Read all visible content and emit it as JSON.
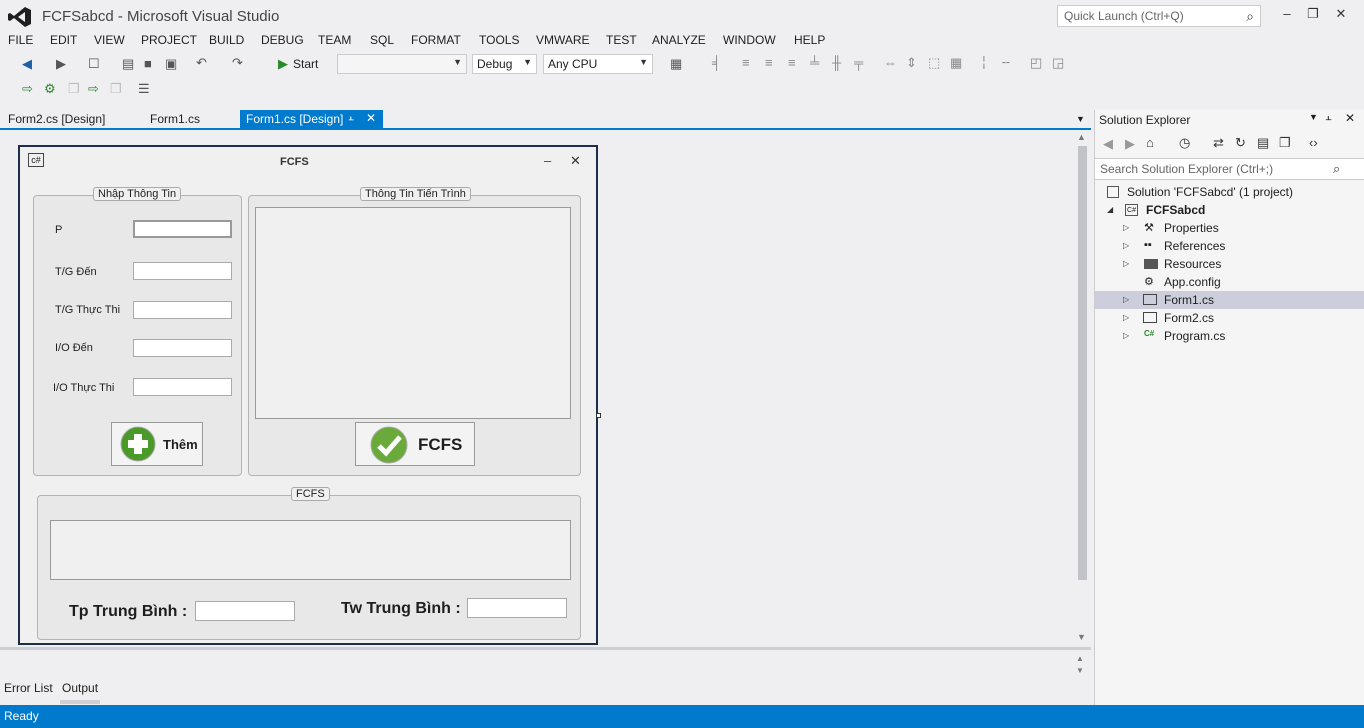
{
  "window": {
    "title": "FCFSabcd - Microsoft Visual Studio",
    "quick_launch_placeholder": "Quick Launch (Ctrl+Q)"
  },
  "menu": [
    "FILE",
    "EDIT",
    "VIEW",
    "PROJECT",
    "BUILD",
    "DEBUG",
    "TEAM",
    "SQL",
    "FORMAT",
    "TOOLS",
    "VMWARE",
    "TEST",
    "ANALYZE",
    "WINDOW",
    "HELP"
  ],
  "toolbar": {
    "start_label": "Start",
    "config_value": "Debug",
    "platform_value": "Any CPU"
  },
  "tabs": [
    "Form2.cs [Design]",
    "Form1.cs",
    "Form1.cs [Design]"
  ],
  "form": {
    "caption": "FCFS",
    "input_group_title": "Nhập Thông Tin",
    "labels": [
      "P",
      "T/G Đến",
      "T/G Thực Thi",
      "I/O Đến",
      "I/O Thực Thi"
    ],
    "add_button": "Thêm",
    "process_group_title": "Thông Tin Tiến Trình",
    "fcfs_button": "FCFS",
    "result_group_title": "FCFS",
    "tp_label": "Tp Trung Bình :",
    "tw_label": "Tw Trung Bình :"
  },
  "bottom_tabs": [
    "Error List",
    "Output"
  ],
  "status": "Ready",
  "solution_explorer": {
    "title": "Solution Explorer",
    "search_placeholder": "Search Solution Explorer (Ctrl+;)",
    "solution": "Solution 'FCFSabcd' (1 project)",
    "project": "FCFSabcd",
    "items": [
      "Properties",
      "References",
      "Resources",
      "App.config",
      "Form1.cs",
      "Form2.cs",
      "Program.cs"
    ],
    "selected": "Form1.cs"
  },
  "colors": {
    "accent": "#007acc",
    "selection": "#cccedb"
  }
}
